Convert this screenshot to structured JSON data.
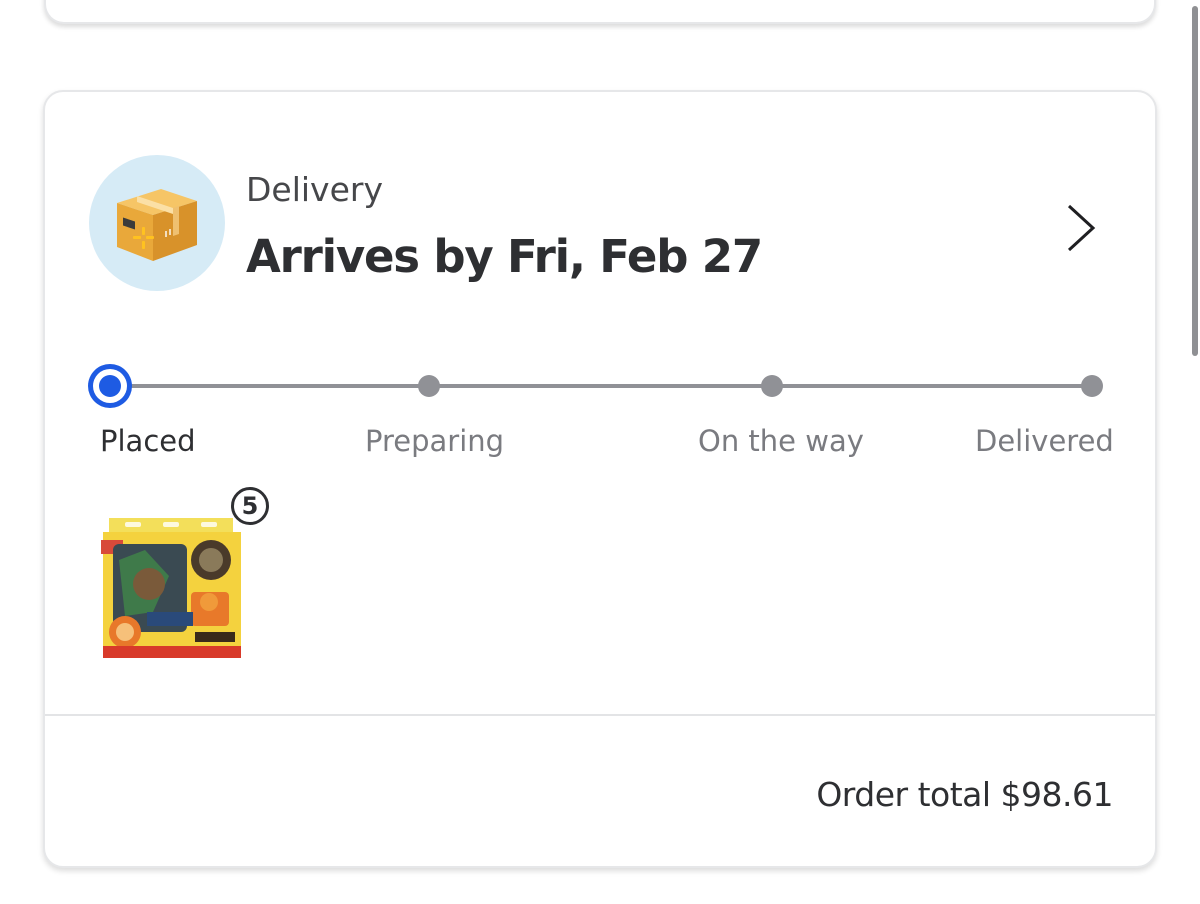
{
  "delivery": {
    "type_label": "Delivery",
    "arrival_text": "Arrives by Fri, Feb 27",
    "icon": "package-box-icon"
  },
  "tracker": {
    "current_step": 0,
    "steps": [
      {
        "label": "Placed"
      },
      {
        "label": "Preparing"
      },
      {
        "label": "On the way"
      },
      {
        "label": "Delivered"
      }
    ],
    "active_color": "#1e5be3",
    "inactive_color": "#909196"
  },
  "items": [
    {
      "image": "trading-card-box-product",
      "quantity": "5"
    }
  ],
  "order": {
    "total_label": "Order total $98.61"
  }
}
